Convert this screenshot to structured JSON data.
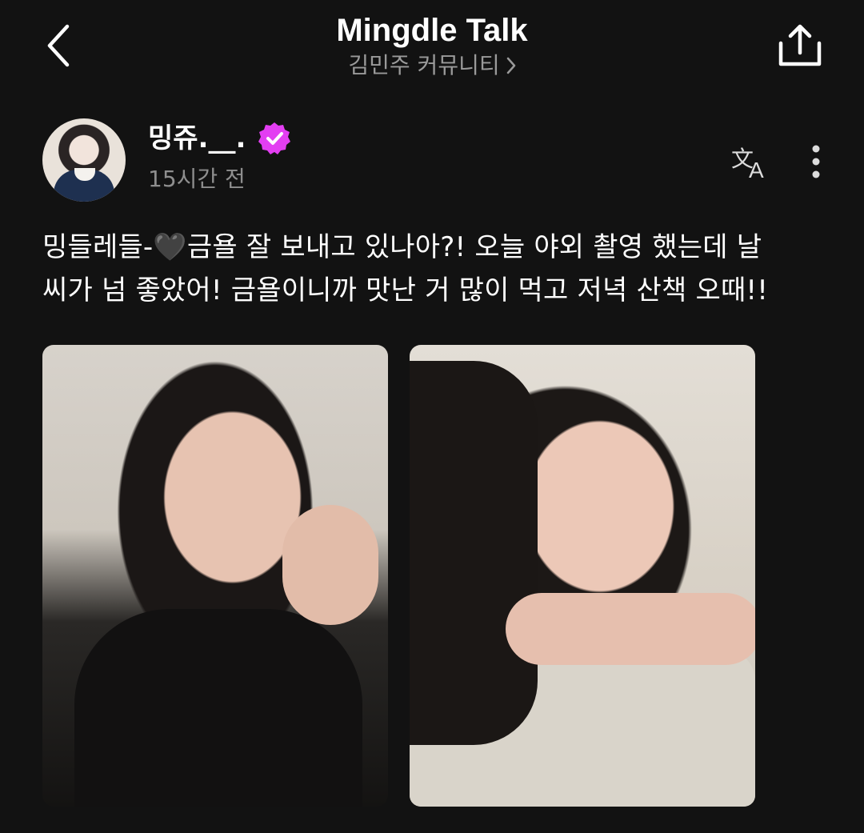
{
  "header": {
    "title": "Mingdle Talk",
    "community_label": "김민주 커뮤니티",
    "back_icon": "chevron-left-icon",
    "share_icon": "share-icon"
  },
  "post": {
    "author_name": "밍쥬.__.",
    "verified_color": "#e33ef2",
    "time_ago": "15시간 전",
    "body_line_1": "밍들레들-🖤금욜 잘 보내고 있나아?! 오늘 야외 촬영 했는데 날",
    "body_line_2": "씨가 넘 좋았어! 금욜이니까 맛난 거 많이 먹고 저녁 산책 오때!!",
    "translate_icon": "translate-icon",
    "more_icon": "more-vertical-icon",
    "photos": [
      "photo-1",
      "photo-2"
    ]
  },
  "colors": {
    "background": "#121212",
    "text_primary": "#ffffff",
    "text_secondary": "#8e8e8e"
  }
}
